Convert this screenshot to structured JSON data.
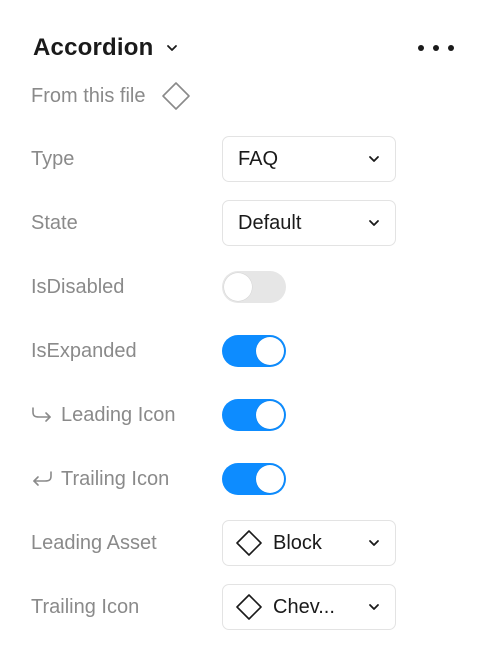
{
  "header": {
    "title": "Accordion",
    "title_chevron_icon": "chevron-down-icon",
    "more_icon": "more-horizontal-icon"
  },
  "source": {
    "label": "From this file",
    "icon": "component-diamond-icon"
  },
  "properties": {
    "type": {
      "label": "Type",
      "value": "FAQ"
    },
    "state": {
      "label": "State",
      "value": "Default"
    },
    "is_disabled": {
      "label": "IsDisabled",
      "checked": false
    },
    "is_expanded": {
      "label": "IsExpanded",
      "checked": true
    },
    "leading_icon": {
      "label": "Leading Icon",
      "icon": "nested-instance-arrow-icon",
      "checked": true
    },
    "trailing_icon": {
      "label": "Trailing Icon",
      "icon": "return-arrow-icon",
      "checked": true
    },
    "leading_asset": {
      "label": "Leading Asset",
      "value": "Block",
      "icon": "component-diamond-icon"
    },
    "trailing_icon_swap": {
      "label": "Trailing Icon",
      "value": "Chev...",
      "icon": "component-diamond-icon"
    }
  },
  "colors": {
    "accent": "#0d8cff",
    "toggle_off": "#e6e6e6",
    "label_text": "#8a8a8a",
    "value_text": "#1a1a1a",
    "border": "#e3e3e3"
  }
}
